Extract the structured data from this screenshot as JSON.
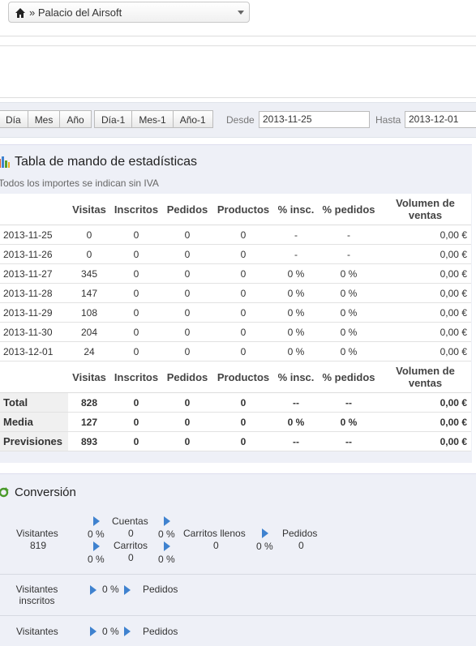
{
  "shop_selector": {
    "label": "» Palacio del Airsoft"
  },
  "toolbar": {
    "period_buttons": [
      "Día",
      "Mes",
      "Año"
    ],
    "prev_buttons": [
      "Día-1",
      "Mes-1",
      "Año-1"
    ],
    "from_label": "Desde",
    "from_value": "2013-11-25",
    "to_label": "Hasta",
    "to_value": "2013-12-01"
  },
  "stats": {
    "title": "Tabla de mando de estadísticas",
    "subtitle": "Todos los importes se indican sin IVA",
    "headers": [
      "",
      "Visitas",
      "Inscritos",
      "Pedidos",
      "Productos",
      "% insc.",
      "% pedidos",
      "Volumen de ventas"
    ],
    "rows": [
      [
        "2013-11-25",
        "0",
        "0",
        "0",
        "0",
        "-",
        "-",
        "0,00 €"
      ],
      [
        "2013-11-26",
        "0",
        "0",
        "0",
        "0",
        "-",
        "-",
        "0,00 €"
      ],
      [
        "2013-11-27",
        "345",
        "0",
        "0",
        "0",
        "0 %",
        "0 %",
        "0,00 €"
      ],
      [
        "2013-11-28",
        "147",
        "0",
        "0",
        "0",
        "0 %",
        "0 %",
        "0,00 €"
      ],
      [
        "2013-11-29",
        "108",
        "0",
        "0",
        "0",
        "0 %",
        "0 %",
        "0,00 €"
      ],
      [
        "2013-11-30",
        "204",
        "0",
        "0",
        "0",
        "0 %",
        "0 %",
        "0,00 €"
      ],
      [
        "2013-12-01",
        "24",
        "0",
        "0",
        "0",
        "0 %",
        "0 %",
        "0,00 €"
      ]
    ],
    "summary": [
      [
        "Total",
        "828",
        "0",
        "0",
        "0",
        "--",
        "--",
        "0,00 €"
      ],
      [
        "Media",
        "127",
        "0",
        "0",
        "0",
        "0 %",
        "0 %",
        "0,00 €"
      ],
      [
        "Previsiones",
        "893",
        "0",
        "0",
        "0",
        "--",
        "--",
        "0,00 €"
      ]
    ]
  },
  "conversion": {
    "title": "Conversión",
    "visitantes_label": "Visitantes",
    "visitantes_value": "819",
    "cuentas_label": "Cuentas",
    "cuentas_value": "0",
    "carritos_label": "Carritos",
    "carritos_value": "0",
    "carritos_llenos_label": "Carritos llenos",
    "carritos_llenos_value": "0",
    "pedidos_label": "Pedidos",
    "pedidos_value": "0",
    "pct_a": "0 %",
    "pct_b": "0 %",
    "pct_c": "0 %",
    "pct_d": "0 %",
    "pct_e": "0 %",
    "row2_left": "Visitantes inscritos",
    "row2_pct": "0 %",
    "row2_right": "Pedidos",
    "row3_left": "Visitantes",
    "row3_pct": "0 %",
    "row3_right": "Pedidos"
  },
  "colors": {
    "accent": "#3f82cf",
    "panel_bg": "#eef0f7"
  }
}
